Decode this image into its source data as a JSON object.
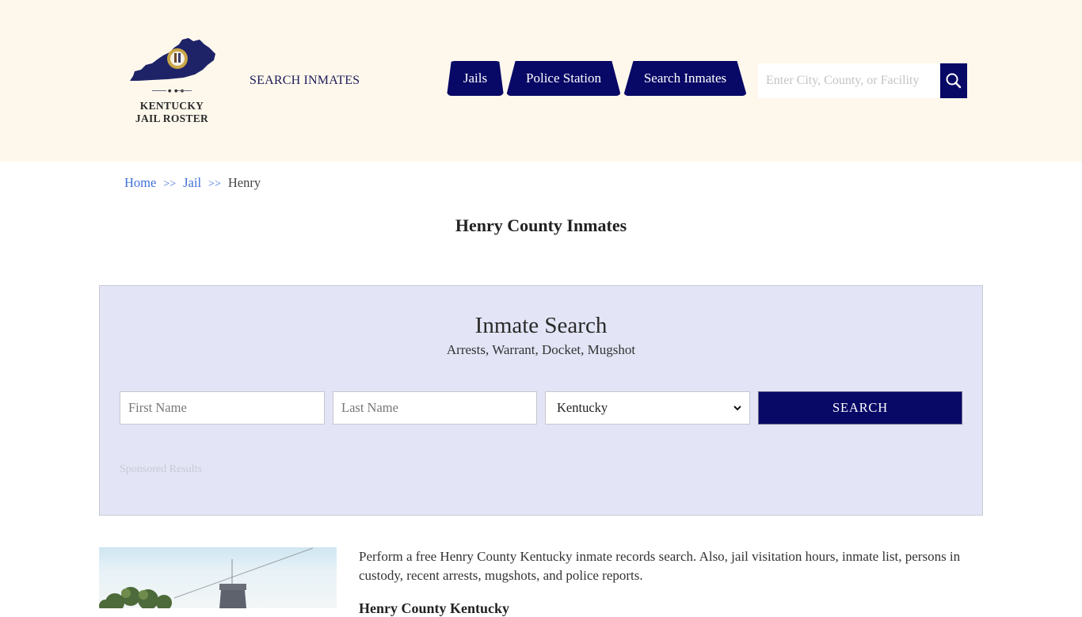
{
  "header": {
    "logo": {
      "line1": "KENTUCKY",
      "line2": "JAIL ROSTER",
      "icon": "kentucky-state-map-seal"
    },
    "search_inmates_link": "SEARCH INMATES",
    "nav": [
      {
        "label": "Jails"
      },
      {
        "label": "Police Station"
      },
      {
        "label": "Search Inmates"
      }
    ],
    "site_search": {
      "placeholder": "Enter City, County, or Facility",
      "value": "",
      "icon": "search-icon"
    }
  },
  "breadcrumb": {
    "items": [
      {
        "label": "Home"
      },
      {
        "label": "Jail"
      },
      {
        "label": "Henry"
      }
    ],
    "separator": ">>"
  },
  "page_title": "Henry County Inmates",
  "inmate_search": {
    "title": "Inmate Search",
    "subtitle": "Arrests, Warrant, Docket, Mugshot",
    "first_name": {
      "placeholder": "First Name",
      "value": ""
    },
    "last_name": {
      "placeholder": "Last Name",
      "value": ""
    },
    "state": {
      "selected": "Kentucky",
      "icon": "chevron-down-icon"
    },
    "search_button": "SEARCH",
    "sponsored": "Sponsored Results"
  },
  "content": {
    "image_alt": "Henry County jail building",
    "intro": "Perform a free Henry County Kentucky inmate records search. Also, jail visitation hours, inmate list, persons in custody, recent arrests, mugshots, and police reports.",
    "section_heading": "Henry County Kentucky"
  },
  "colors": {
    "header_bg": "#fef8ec",
    "brand_navy": "#080866",
    "panel_bg": "#e3e5f6",
    "link_blue": "#3e6fd8"
  }
}
